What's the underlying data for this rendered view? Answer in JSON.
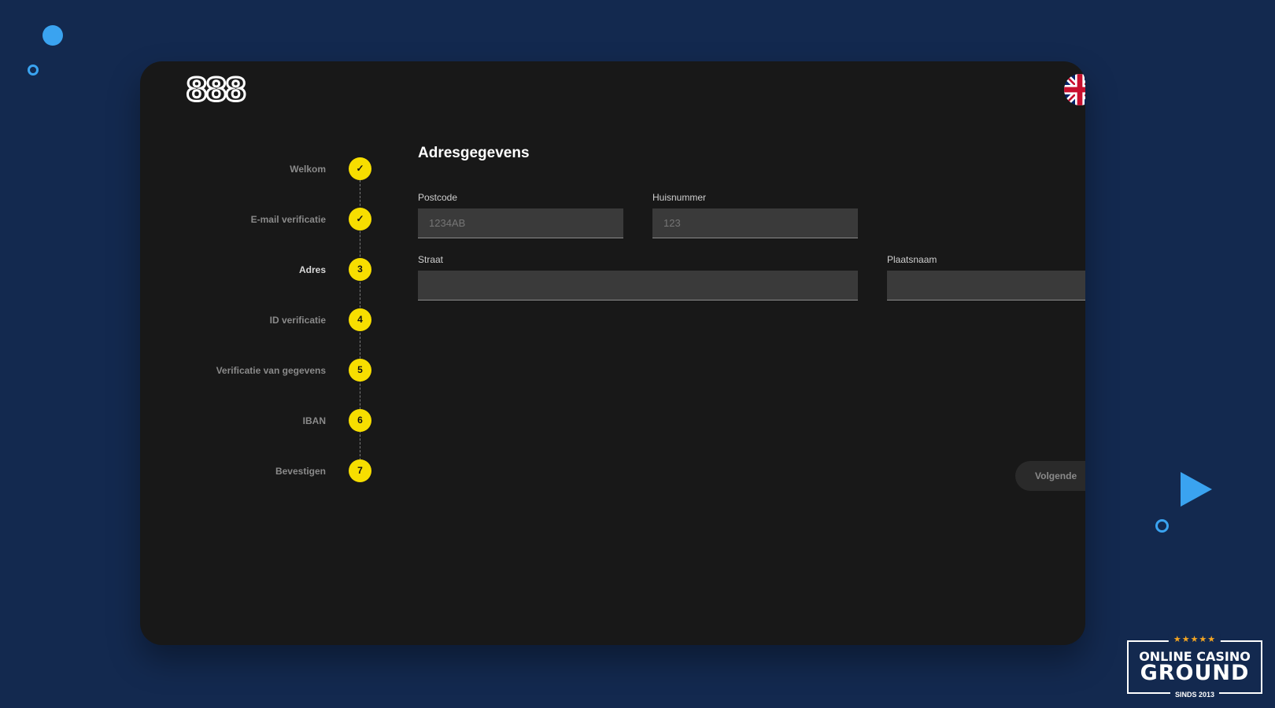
{
  "brand": {
    "logo": "888"
  },
  "language": {
    "flag": "uk-flag-icon"
  },
  "steps": [
    {
      "label": "Welkom",
      "marker": "✓",
      "status": "done"
    },
    {
      "label": "E-mail verificatie",
      "marker": "✓",
      "status": "done"
    },
    {
      "label": "Adres",
      "marker": "3",
      "status": "active"
    },
    {
      "label": "ID verificatie",
      "marker": "4",
      "status": "pending"
    },
    {
      "label": "Verificatie van gegevens",
      "marker": "5",
      "status": "pending"
    },
    {
      "label": "IBAN",
      "marker": "6",
      "status": "pending"
    },
    {
      "label": "Bevestigen",
      "marker": "7",
      "status": "pending"
    }
  ],
  "form": {
    "title": "Adresgegevens",
    "postcode": {
      "label": "Postcode",
      "value": "",
      "placeholder": "1234AB"
    },
    "huisnummer": {
      "label": "Huisnummer",
      "value": "",
      "placeholder": "123"
    },
    "straat": {
      "label": "Straat",
      "value": "",
      "placeholder": ""
    },
    "plaatsnaam": {
      "label": "Plaatsnaam",
      "value": "",
      "placeholder": ""
    },
    "next_label": "Volgende"
  },
  "badge": {
    "stars": "★★★★★",
    "line1": "ONLINE CASINO",
    "line2": "GROUND",
    "line3": "SINDS 2013"
  },
  "colors": {
    "background": "#13294f",
    "panel": "#181818",
    "step_accent": "#f7de00",
    "decor_accent": "#3aa3f0"
  }
}
